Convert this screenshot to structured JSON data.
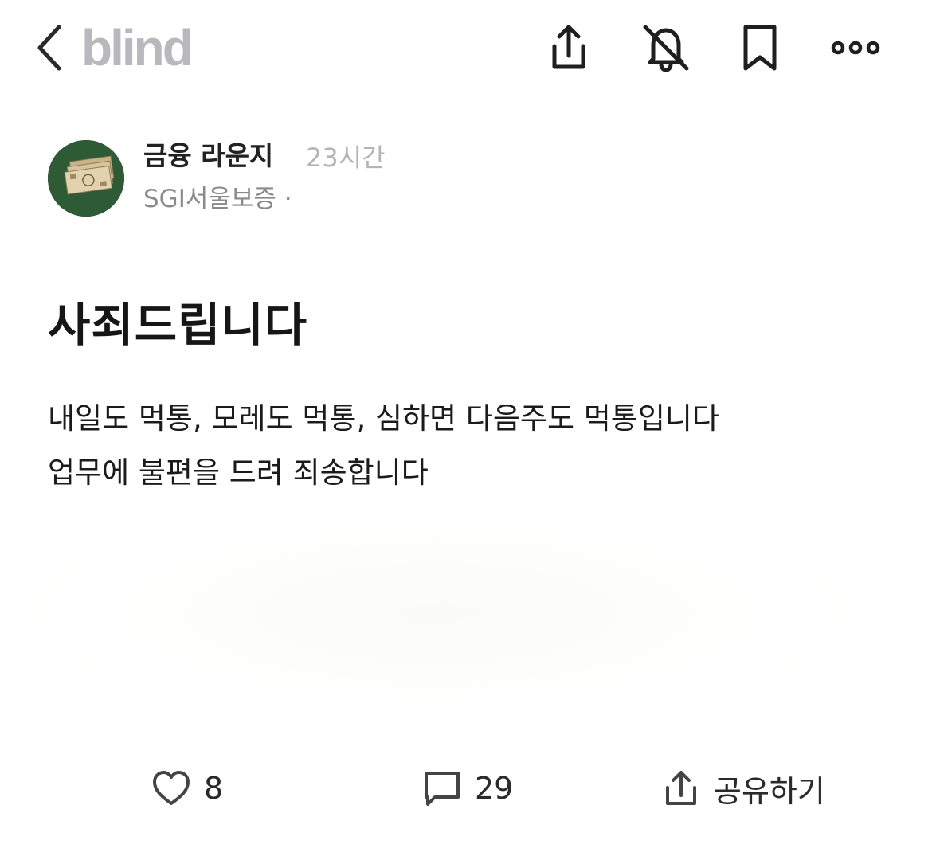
{
  "header": {
    "logo": "blind",
    "icons": [
      "chevron-left-icon",
      "share-icon",
      "bell-off-icon",
      "bookmark-icon",
      "more-icon"
    ]
  },
  "post": {
    "author_name": "금융 라운지",
    "time": "23시간",
    "company": "SGI서울보증 ·",
    "title": "사죄드립니다",
    "body": [
      "내일도 먹통, 모레도 먹통, 심하면 다음주도 먹통입니다",
      "업무에 불편을 드려 죄송합니다"
    ]
  },
  "actions": {
    "like_count": "8",
    "comment_count": "29",
    "share_label": "공유하기"
  },
  "colors": {
    "logo": "#b9b9bd",
    "avatar_bg": "#2e5a35",
    "muted_text": "#8a8a8e"
  }
}
